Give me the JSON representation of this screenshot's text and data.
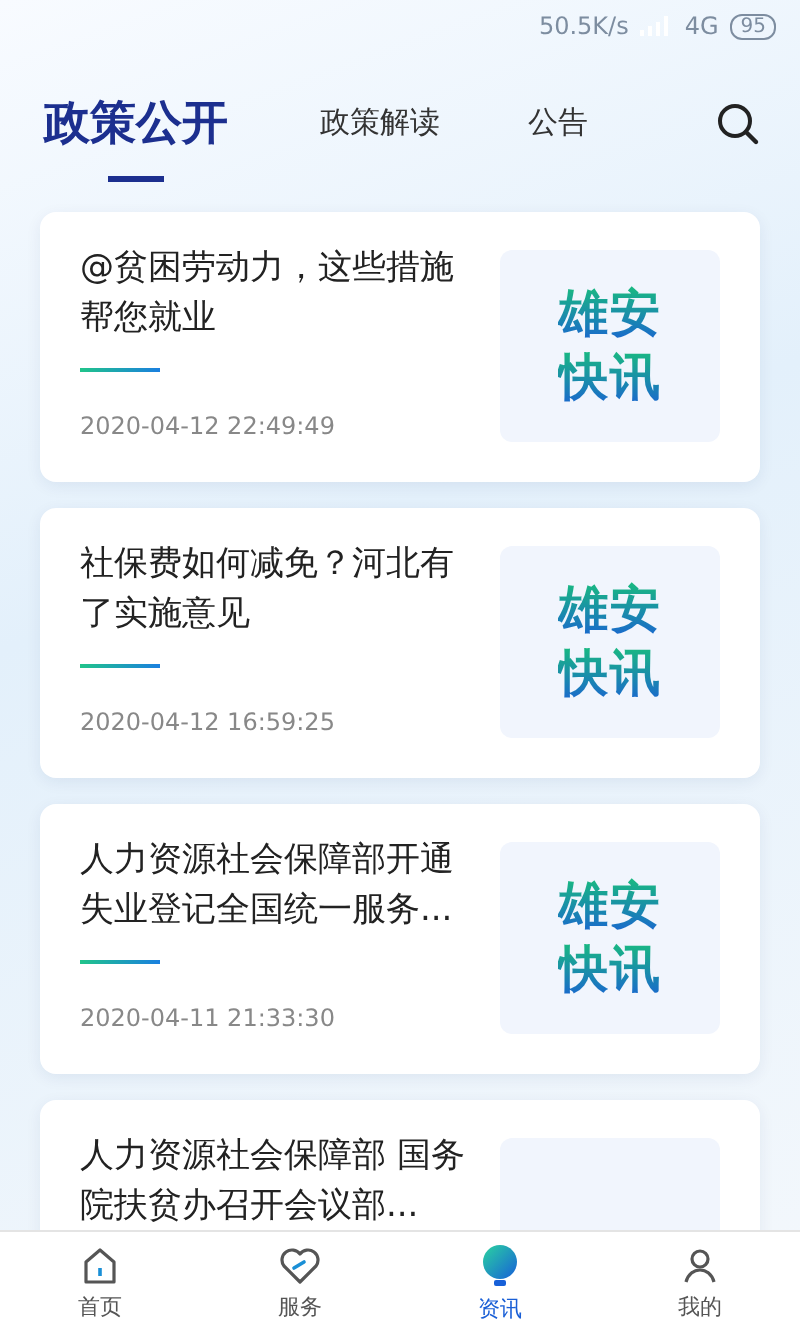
{
  "status_bar": {
    "speed": "50.5K/s",
    "network": "4G",
    "battery": "95"
  },
  "tabs": [
    {
      "label": "政策公开",
      "selected": true
    },
    {
      "label": "政策解读",
      "selected": false
    },
    {
      "label": "公告",
      "selected": false
    }
  ],
  "articles": [
    {
      "title": "@贫困劳动力，这些措施帮您就业",
      "time": "2020-04-12 22:49:49",
      "thumb": [
        "雄安",
        "快讯"
      ]
    },
    {
      "title": "社保费如何减免？河北有了实施意见",
      "time": "2020-04-12 16:59:25",
      "thumb": [
        "雄安",
        "快讯"
      ]
    },
    {
      "title": "人力资源社会保障部开通失业登记全国统一服务...",
      "time": "2020-04-11 21:33:30",
      "thumb": [
        "雄安",
        "快讯"
      ]
    },
    {
      "title": "人力资源社会保障部 国务院扶贫办召开会议部..."
    }
  ],
  "nav": [
    {
      "label": "首页",
      "kind": "home",
      "selected": false
    },
    {
      "label": "服务",
      "kind": "heart",
      "selected": false
    },
    {
      "label": "资讯",
      "kind": "bulb",
      "selected": true
    },
    {
      "label": "我的",
      "kind": "person",
      "selected": false
    }
  ]
}
